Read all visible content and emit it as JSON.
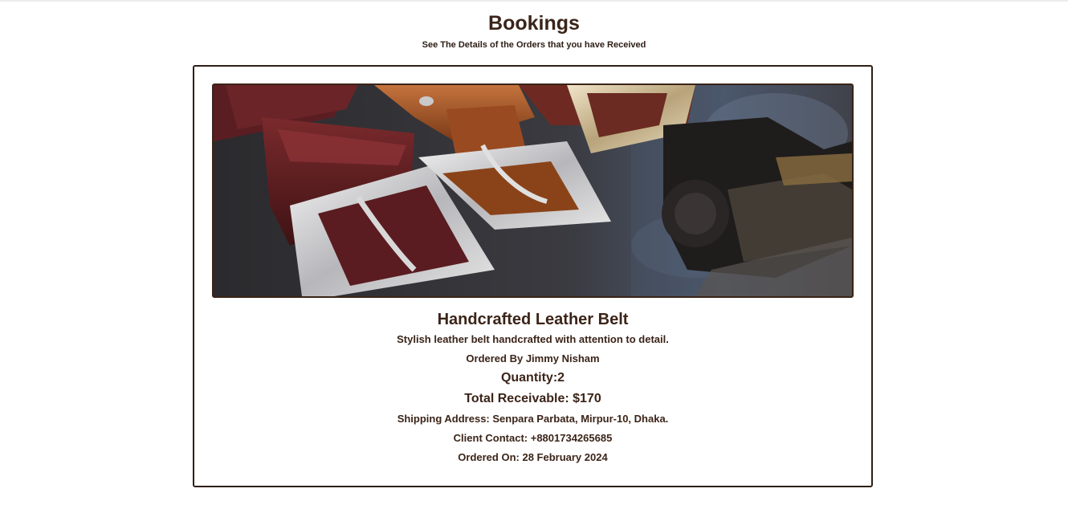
{
  "header": {
    "title": "Bookings",
    "subtitle": "See The Details of the Orders that you have Received"
  },
  "booking": {
    "image_alt": "leather belts",
    "product_name": "Handcrafted Leather Belt",
    "description": "Stylish leather belt handcrafted with attention to detail.",
    "ordered_by": "Ordered By Jimmy Nisham",
    "quantity": "Quantity:2",
    "total": "Total Receivable: $170",
    "shipping_address": "Shipping Address: Senpara Parbata, Mirpur-10, Dhaka.",
    "client_contact": "Client Contact: +8801734265685",
    "ordered_on": "Ordered On: 28 February 2024"
  },
  "colors": {
    "text_primary": "#3b2418",
    "card_border": "#2f1f17",
    "background": "#ffffff"
  }
}
